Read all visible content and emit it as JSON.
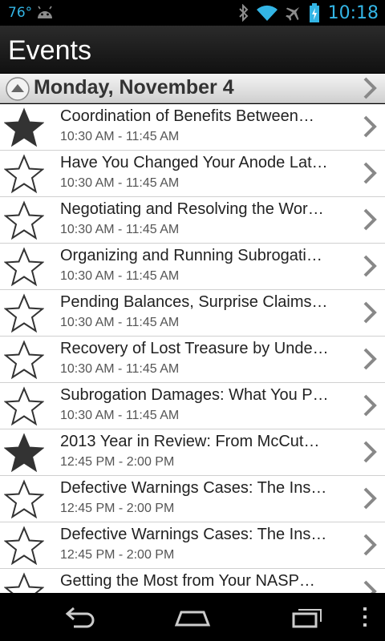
{
  "status_bar": {
    "temperature": "76°",
    "time": "10:18",
    "icons": [
      "android-icon",
      "bluetooth-icon",
      "wifi-icon",
      "airplane-mode-icon",
      "battery-icon"
    ],
    "accent_color": "#33b5e5"
  },
  "action_bar": {
    "title": "Events"
  },
  "section": {
    "date": "Monday, November 4"
  },
  "events": [
    {
      "title": "Coordination of Benefits Between…",
      "time": "10:30 AM - 11:45 AM",
      "starred": true
    },
    {
      "title": "Have You Changed Your Anode Lat…",
      "time": "10:30 AM - 11:45 AM",
      "starred": false
    },
    {
      "title": "Negotiating and Resolving the Wor…",
      "time": "10:30 AM - 11:45 AM",
      "starred": false
    },
    {
      "title": "Organizing and Running Subrogati…",
      "time": "10:30 AM - 11:45 AM",
      "starred": false
    },
    {
      "title": "Pending Balances, Surprise Claims…",
      "time": "10:30 AM - 11:45 AM",
      "starred": false
    },
    {
      "title": "Recovery of Lost Treasure by Unde…",
      "time": "10:30 AM - 11:45 AM",
      "starred": false
    },
    {
      "title": "Subrogation Damages:  What You P…",
      "time": "10:30 AM - 11:45 AM",
      "starred": false
    },
    {
      "title": "2013 Year in Review:  From McCut…",
      "time": "12:45 PM - 2:00 PM",
      "starred": true
    },
    {
      "title": "Defective Warnings Cases:  The Ins…",
      "time": "12:45 PM - 2:00 PM",
      "starred": false
    },
    {
      "title": "Defective Warnings Cases:  The Ins…",
      "time": "12:45 PM - 2:00 PM",
      "starred": false
    },
    {
      "title": "Getting the Most from Your NASP…",
      "time": "",
      "starred": false
    }
  ],
  "nav_bar": {
    "buttons": [
      "back-icon",
      "home-icon",
      "recent-apps-icon",
      "overflow-menu-icon"
    ]
  }
}
